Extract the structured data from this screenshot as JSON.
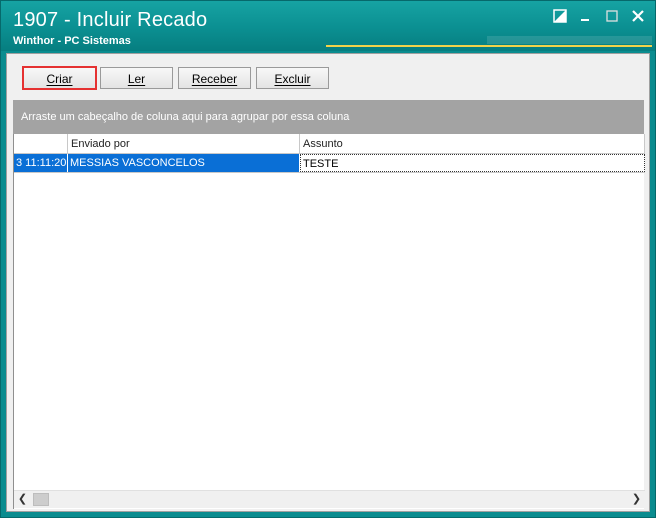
{
  "window": {
    "title": "1907 - Incluir Recado",
    "subtitle": "Winthor - PC Sistemas"
  },
  "toolbar": {
    "criar_label": "Criar",
    "ler_label": "Ler",
    "receber_label": "Receber",
    "excluir_label": "Excluir"
  },
  "grid": {
    "group_hint": "Arraste um cabeçalho de coluna aqui para agrupar por essa coluna",
    "columns": [
      "",
      "Enviado por",
      "Assunto"
    ],
    "rows": [
      {
        "time": "3 11:11:20",
        "sender": "MESSIAS VASCONCELOS",
        "subject": "TESTE"
      }
    ]
  },
  "colors": {
    "titlebar": "#0b8f91",
    "selection": "#0a6fd6",
    "highlight": "#e53131"
  },
  "icons": {
    "restore": "restore-icon",
    "minimize": "minimize-icon",
    "maximize": "maximize-icon",
    "close": "close-icon",
    "scroll_left": "chevron-left-icon",
    "scroll_right": "chevron-right-icon"
  }
}
